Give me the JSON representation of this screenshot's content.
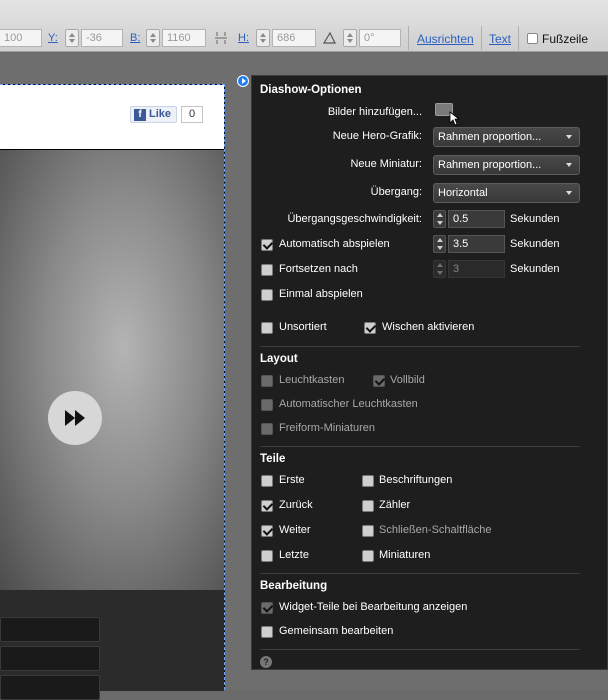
{
  "toolbar": {
    "w_value": "100",
    "y_label": "Y:",
    "y_value": "-36",
    "b_label": "B:",
    "b_value": "1160",
    "h_label": "H:",
    "h_value": "686",
    "angle_value": "0°",
    "ausrichten": "Ausrichten",
    "text": "Text",
    "fusszeile": "Fußzeile"
  },
  "page": {
    "fb_like": "Like",
    "fb_count": "0"
  },
  "panel": {
    "title": "Diashow-Optionen",
    "bilder_hinzufuegen": "Bilder hinzufügen...",
    "neue_hero_label": "Neue Hero-Grafik:",
    "neue_hero_value": "Rahmen proportion...",
    "neue_mini_label": "Neue Miniatur:",
    "neue_mini_value": "Rahmen proportion...",
    "uebergang_label": "Übergang:",
    "uebergang_value": "Horizontal",
    "geschw_label": "Übergangsgeschwindigkeit:",
    "geschw_value": "0.5",
    "sekunden": "Sekunden",
    "auto_label": "Automatisch abspielen",
    "auto_value": "3.5",
    "fortsetzen_label": "Fortsetzen nach",
    "fortsetzen_value": "3",
    "einmal_label": "Einmal abspielen",
    "unsortiert_label": "Unsortiert",
    "wischen_label": "Wischen aktivieren",
    "layout_title": "Layout",
    "leuchtkasten": "Leuchtkasten",
    "vollbild": "Vollbild",
    "auto_leuchtkasten": "Automatischer Leuchtkasten",
    "freiform": "Freiform-Miniaturen",
    "teile_title": "Teile",
    "erste": "Erste",
    "beschriftungen": "Beschriftungen",
    "zurueck": "Zurück",
    "zaehler": "Zähler",
    "weiter": "Weiter",
    "schliessen": "Schließen-Schaltfläche",
    "letzte": "Letzte",
    "miniaturen": "Miniaturen",
    "bearbeitung_title": "Bearbeitung",
    "widget_teile": "Widget-Teile bei Bearbeitung anzeigen",
    "gemeinsam": "Gemeinsam bearbeiten",
    "help": "?"
  }
}
